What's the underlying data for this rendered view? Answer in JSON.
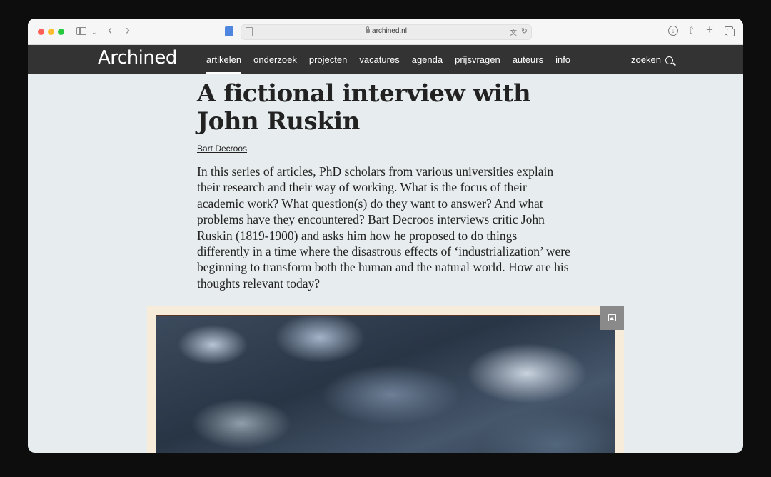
{
  "browser": {
    "url": "archined.nl"
  },
  "site": {
    "logo": "Archined",
    "nav": [
      {
        "label": "artikelen",
        "active": true
      },
      {
        "label": "onderzoek",
        "active": false
      },
      {
        "label": "projecten",
        "active": false
      },
      {
        "label": "vacatures",
        "active": false
      },
      {
        "label": "agenda",
        "active": false
      },
      {
        "label": "prijsvragen",
        "active": false
      },
      {
        "label": "auteurs",
        "active": false
      },
      {
        "label": "info",
        "active": false
      }
    ],
    "search_label": "zoeken"
  },
  "article": {
    "title": "A fictional interview with John Ruskin",
    "author": "Bart Decroos",
    "intro": "In this series of articles, PhD scholars from various universities explain their research and their way of working. What is the focus of their academic work? What question(s) do they want to answer? And what problems have they encountered? Bart Decroos interviews critic John Ruskin (1819-1900) and asks him how he proposed to do things differently in a time where the disastrous effects of ‘industrialization’ were beginning to transform both the human and the natural world. How are his thoughts relevant today?"
  },
  "colors": {
    "nav_bg": "#333333",
    "page_bg": "#e7ecee",
    "text": "#222222"
  }
}
